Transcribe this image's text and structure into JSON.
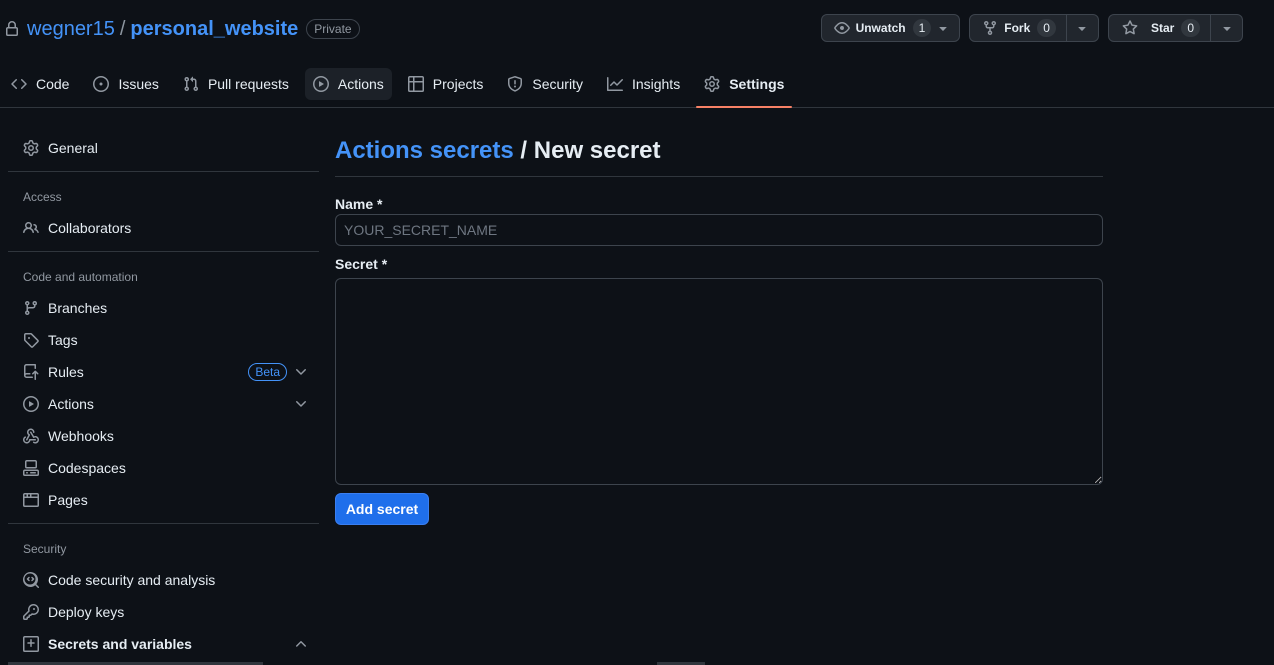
{
  "repo": {
    "owner": "wegner15",
    "separator": "/",
    "name": "personal_website",
    "visibility": "Private"
  },
  "header_actions": {
    "unwatch": {
      "label": "Unwatch",
      "count": "1"
    },
    "fork": {
      "label": "Fork",
      "count": "0"
    },
    "star": {
      "label": "Star",
      "count": "0"
    }
  },
  "tabs": [
    {
      "label": "Code",
      "icon": "code-icon"
    },
    {
      "label": "Issues",
      "icon": "issue-icon"
    },
    {
      "label": "Pull requests",
      "icon": "pull-request-icon"
    },
    {
      "label": "Actions",
      "icon": "play-icon"
    },
    {
      "label": "Projects",
      "icon": "table-icon"
    },
    {
      "label": "Security",
      "icon": "shield-icon"
    },
    {
      "label": "Insights",
      "icon": "graph-icon"
    },
    {
      "label": "Settings",
      "icon": "gear-icon",
      "selected": true
    }
  ],
  "sidebar": {
    "general": "General",
    "access_heading": "Access",
    "collaborators": "Collaborators",
    "code_heading": "Code and automation",
    "branches": "Branches",
    "tags": "Tags",
    "rules": "Rules",
    "rules_badge": "Beta",
    "actions": "Actions",
    "webhooks": "Webhooks",
    "codespaces": "Codespaces",
    "pages": "Pages",
    "security_heading": "Security",
    "code_security": "Code security and analysis",
    "deploy_keys": "Deploy keys",
    "secrets_variables": "Secrets and variables"
  },
  "main": {
    "breadcrumb_link": "Actions secrets",
    "breadcrumb_sep": " / ",
    "breadcrumb_current": "New secret",
    "name_label": "Name *",
    "name_placeholder": "YOUR_SECRET_NAME",
    "name_value": "",
    "secret_label": "Secret *",
    "secret_value": "",
    "submit_label": "Add secret"
  },
  "colors": {
    "background": "#0d1117",
    "link": "#4493f8",
    "accent_underline": "#f78166",
    "primary_button": "#1f6feb"
  }
}
